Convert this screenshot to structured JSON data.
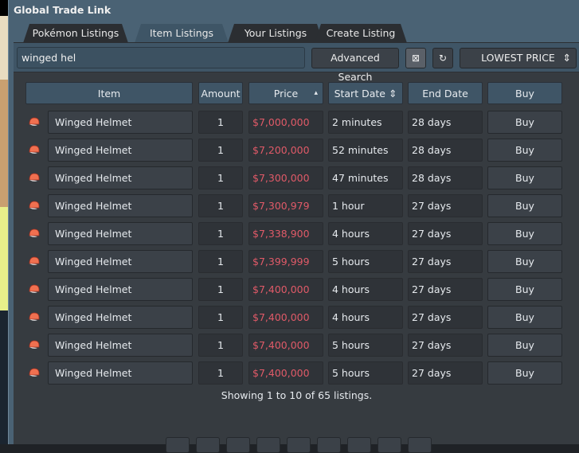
{
  "window": {
    "title": "Global Trade Link"
  },
  "tabs": [
    {
      "label": "Pokémon Listings",
      "active": false
    },
    {
      "label": "Item Listings",
      "active": true
    },
    {
      "label": "Your Listings",
      "active": false
    },
    {
      "label": "Create Listing",
      "active": false
    }
  ],
  "search": {
    "value": "winged hel",
    "advanced_label": "Advanced Search",
    "clear_icon": "⊠",
    "refresh_icon": "↻",
    "sort_value": "LOWEST PRICE",
    "sort_icon": "⇕"
  },
  "table": {
    "headers": {
      "item": "Item",
      "amount": "Amount",
      "price": "Price",
      "price_sort": "▴",
      "start": "Start Date",
      "start_sort": "⇕",
      "end": "End Date",
      "buy": "Buy"
    },
    "rows": [
      {
        "item": "Winged Helmet",
        "amount": "1",
        "price": "$7,000,000",
        "start": "2 minutes",
        "end": "28 days",
        "buy": "Buy"
      },
      {
        "item": "Winged Helmet",
        "amount": "1",
        "price": "$7,200,000",
        "start": "52 minutes",
        "end": "28 days",
        "buy": "Buy"
      },
      {
        "item": "Winged Helmet",
        "amount": "1",
        "price": "$7,300,000",
        "start": "47 minutes",
        "end": "28 days",
        "buy": "Buy"
      },
      {
        "item": "Winged Helmet",
        "amount": "1",
        "price": "$7,300,979",
        "start": "1 hour",
        "end": "27 days",
        "buy": "Buy"
      },
      {
        "item": "Winged Helmet",
        "amount": "1",
        "price": "$7,338,900",
        "start": "4 hours",
        "end": "27 days",
        "buy": "Buy"
      },
      {
        "item": "Winged Helmet",
        "amount": "1",
        "price": "$7,399,999",
        "start": "5 hours",
        "end": "27 days",
        "buy": "Buy"
      },
      {
        "item": "Winged Helmet",
        "amount": "1",
        "price": "$7,400,000",
        "start": "4 hours",
        "end": "27 days",
        "buy": "Buy"
      },
      {
        "item": "Winged Helmet",
        "amount": "1",
        "price": "$7,400,000",
        "start": "4 hours",
        "end": "27 days",
        "buy": "Buy"
      },
      {
        "item": "Winged Helmet",
        "amount": "1",
        "price": "$7,400,000",
        "start": "5 hours",
        "end": "27 days",
        "buy": "Buy"
      },
      {
        "item": "Winged Helmet",
        "amount": "1",
        "price": "$7,400,000",
        "start": "5 hours",
        "end": "27 days",
        "buy": "Buy"
      }
    ]
  },
  "footer": {
    "status": "Showing 1 to 10 of 65 listings."
  },
  "colors": {
    "price": "#e05a68",
    "header": "#3f5566",
    "panel": "#363b40"
  }
}
